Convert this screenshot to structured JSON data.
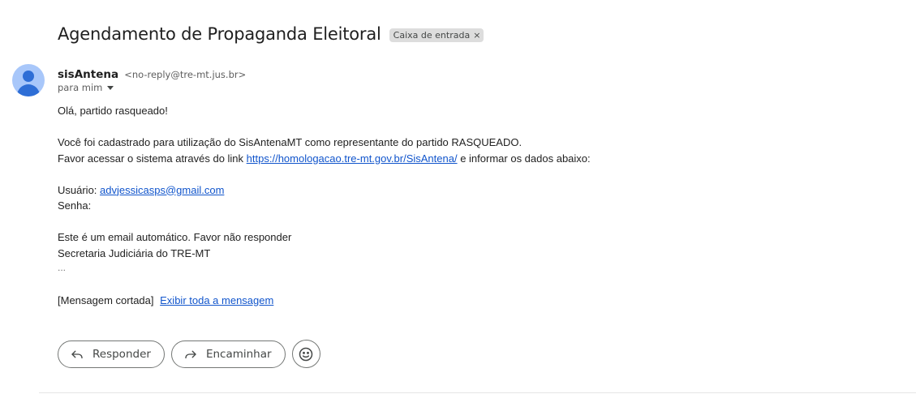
{
  "message": {
    "subject": "Agendamento de Propaganda Eleitoral",
    "label": "Caixa de entrada",
    "label_close": "×",
    "sender_name": "sisAntena",
    "sender_email": "<no-reply@tre-mt.jus.br>",
    "recipient": "para mim"
  },
  "body": {
    "greeting": "Olá, partido rasqueado!",
    "line1": "Você foi cadastrado para utilização do SisAntenaMT como representante do partido RASQUEADO.",
    "line2_before": "Favor acessar o sistema através do link",
    "link": "https://homologacao.tre-mt.gov.br/SisAntena/",
    "line2_after": "e informar os dados abaixo:",
    "user_label": "Usuário:",
    "user_email": "advjessicasps@gmail.com",
    "password_label": "Senha:",
    "auto_notice": "Este é um email automático. Favor não responder",
    "signature": "Secretaria Judiciária do TRE-MT",
    "ellipsis": "...",
    "truncated_label": "[Mensagem cortada]",
    "show_full": "Exibir toda a mensagem"
  },
  "actions": {
    "reply": "Responder",
    "forward": "Encaminhar",
    "emoji_icon": "smiley-icon"
  },
  "colors": {
    "link": "#1155cc",
    "avatar_bg": "#a8c7fa",
    "avatar_fg": "#2e6ed6",
    "chip_bg": "#dddddd"
  }
}
